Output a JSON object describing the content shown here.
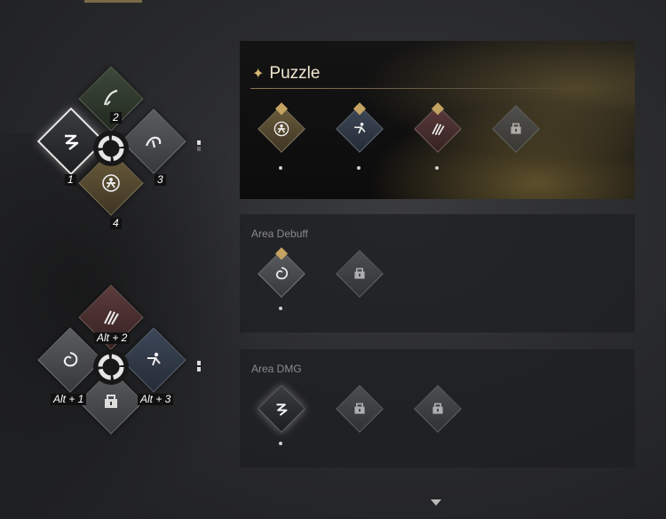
{
  "skill_wheels": [
    {
      "slots": [
        {
          "key": "1",
          "icon": "lightning-icon",
          "selected": true
        },
        {
          "key": "2",
          "icon": "blade-icon"
        },
        {
          "key": "3",
          "icon": "beast-icon"
        },
        {
          "key": "4",
          "icon": "archer-icon"
        }
      ]
    },
    {
      "slots": [
        {
          "key": "Alt + 1",
          "icon": "vortex-icon"
        },
        {
          "key": "Alt + 2",
          "icon": "claw-icon"
        },
        {
          "key": "Alt + 3",
          "icon": "kick-icon"
        },
        {
          "key": "",
          "icon": "lock-icon"
        }
      ]
    }
  ],
  "panels": {
    "puzzle": {
      "title": "Puzzle",
      "skills": [
        "archer-icon",
        "kick-icon",
        "claw-icon",
        "lock-icon"
      ]
    },
    "area_debuff": {
      "title": "Area Debuff",
      "skills": [
        "vortex-icon",
        "lock-icon"
      ]
    },
    "area_dmg": {
      "title": "Area DMG",
      "skills": [
        "lightning-icon",
        "lock-icon",
        "lock-icon"
      ]
    }
  },
  "colors": {
    "accent_gold": "#c4a261",
    "title": "#f1e6cf"
  }
}
